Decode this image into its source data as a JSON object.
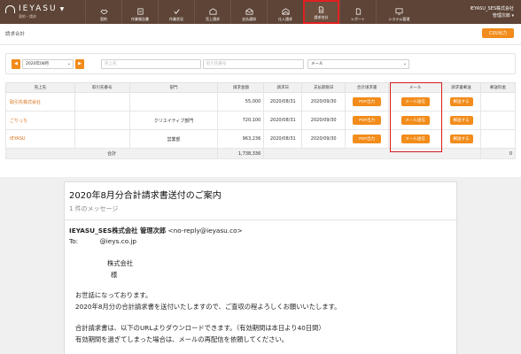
{
  "app": {
    "brand": "IEYASU",
    "brand_sub": "契約・請求",
    "nav": [
      {
        "label": "契約",
        "icon": "handshake-icon"
      },
      {
        "label": "作業報告書",
        "icon": "report-icon"
      },
      {
        "label": "作業状況",
        "icon": "check-icon"
      },
      {
        "label": "売上請求",
        "icon": "invoice-icon"
      },
      {
        "label": "支払通知",
        "icon": "payment-icon"
      },
      {
        "label": "仕入請求",
        "icon": "purchase-icon"
      },
      {
        "label": "請求合計",
        "icon": "document-icon"
      },
      {
        "label": "レポート",
        "icon": "chart-icon"
      },
      {
        "label": "システム管理",
        "icon": "monitor-icon"
      }
    ],
    "account": {
      "company": "IEYASU_SES株式会社",
      "user": "管理次郎"
    },
    "highlight_color": "#d81c1c",
    "accent_color": "#f28c1a",
    "nav_color": "#5d4436"
  },
  "page": {
    "title": "請求合計",
    "csv_button": "CSV出力"
  },
  "filter": {
    "prev": "◀",
    "month": "2020年08月",
    "next": "▶",
    "customer_placeholder": "売上先",
    "client_code_placeholder": "取引先番号",
    "mail_select": "メール"
  },
  "table": {
    "headers": [
      "売上先",
      "取引先番号",
      "部門",
      "請求金額",
      "請求日",
      "支払期限日",
      "合計請求書",
      "メール",
      "請求書郵送",
      "郵送料金"
    ],
    "rows": [
      {
        "customer": "取引先株式会社",
        "code": "",
        "dept": "",
        "amount": "55,000",
        "invoice_date": "2020/08/31",
        "due_date": "2020/09/30",
        "pdf": "PDF出力",
        "mail": "メール送信",
        "post": "郵送する",
        "fee": ""
      },
      {
        "customer": "ごりっち",
        "code": "",
        "dept": "クリエイティブ部門",
        "amount": "720,100",
        "invoice_date": "2020/08/31",
        "due_date": "2020/09/30",
        "pdf": "PDF出力",
        "mail": "メール送信",
        "post": "郵送する",
        "fee": ""
      },
      {
        "customer": "IEYASU",
        "code": "",
        "dept": "営業部",
        "amount": "963,236",
        "invoice_date": "2020/08/31",
        "due_date": "2020/09/30",
        "pdf": "PDF出力",
        "mail": "メール送信",
        "post": "郵送する",
        "fee": ""
      }
    ],
    "total_label": "合計",
    "total_amount": "1,738,336",
    "total_fee": "0"
  },
  "email": {
    "subject": "2020年8月分合計請求書送付のご案内",
    "count": "1 件のメッセージ",
    "sender_name": "IEYASU_SES株式会社 管理次郎",
    "sender_address": "<no-reply@ieyasu.co>",
    "to_label": "To:",
    "to_address": "@ieys.co.jp",
    "recipient_company": "株式会社",
    "recipient_honorific": "様",
    "body": [
      "お世話になっております。",
      "2020年8月分の合計請求書を送付いたしますので、ご査収の程よろしくお願いいたします。",
      "合計請求書は、以下のURLよりダウンロードできます。（有効期間は本日より40日間）",
      "有効期間を過ぎてしまった場合は、メールの再配信を依頼してください。"
    ]
  }
}
